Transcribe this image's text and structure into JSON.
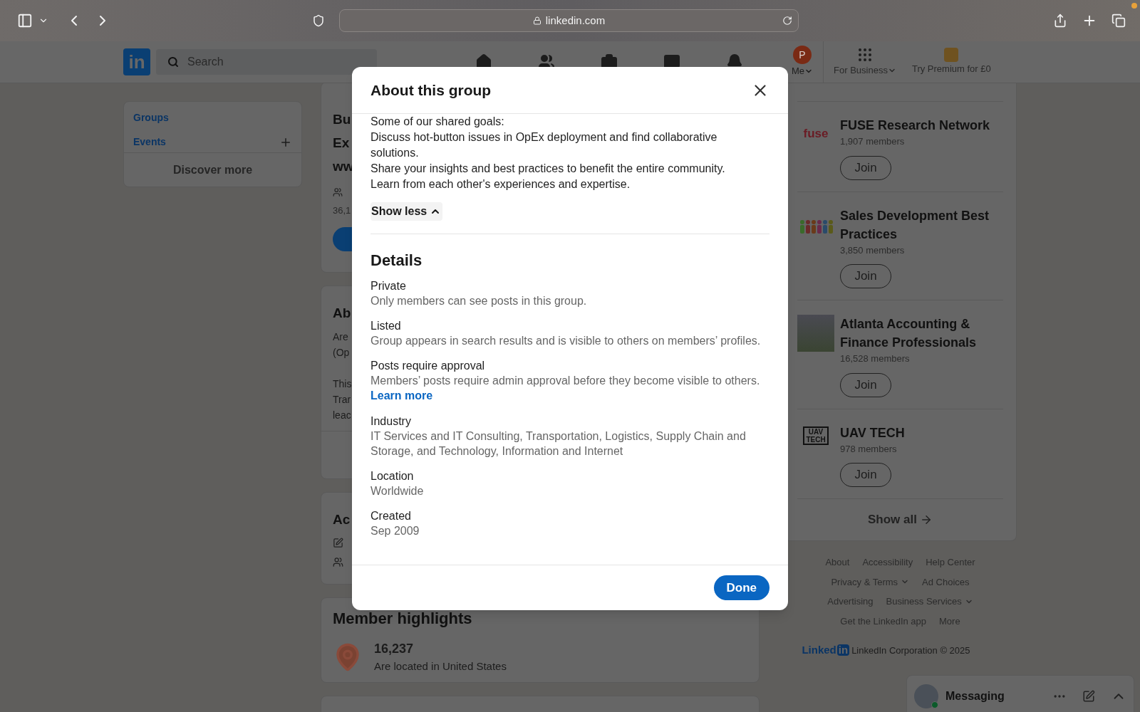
{
  "browser": {
    "url": "linkedin.com"
  },
  "nav": {
    "logo_text": "in",
    "search_placeholder": "Search",
    "avatar_letter": "P",
    "me_label": "Me",
    "for_business": "For Business",
    "premium": "Try Premium for £0"
  },
  "left_nav": {
    "items": [
      {
        "label": "Groups",
        "add": false
      },
      {
        "label": "Events",
        "add": true
      }
    ],
    "discover": "Discover more"
  },
  "group_card": {
    "title_lines": [
      "Bu",
      "Ex",
      "ww"
    ],
    "members": "36,1"
  },
  "about_card": {
    "title": "Ab",
    "paragraphs": [
      [
        "Are",
        "(Op"
      ],
      [
        "This",
        "Trar",
        "leac"
      ]
    ]
  },
  "activity_card": {
    "title": "Ac"
  },
  "member_highlights": {
    "title": "Member highlights",
    "count": "16,237",
    "text": "Are located in United States"
  },
  "suggested_groups": [
    {
      "name": "FUSE Research Network",
      "members": "1,907 members",
      "join": "Join",
      "logo": {
        "kind": "text",
        "text": "fuse"
      }
    },
    {
      "name": "Sales Development Best Practices",
      "members": "3,850 members",
      "join": "Join",
      "logo": {
        "kind": "figures"
      }
    },
    {
      "name": "Atlanta Accounting & Finance Professionals",
      "members": "16,528 members",
      "join": "Join",
      "logo": {
        "kind": "photo"
      }
    },
    {
      "name": "UAV TECH",
      "members": "978 members",
      "join": "Join",
      "logo": {
        "kind": "boxed-text",
        "text": "UAV TECH"
      }
    }
  ],
  "show_all": "Show all",
  "footer_links": [
    [
      {
        "label": "About",
        "menu": false
      },
      {
        "label": "Accessibility",
        "menu": false
      },
      {
        "label": "Help Center",
        "menu": false
      }
    ],
    [
      {
        "label": "Privacy & Terms",
        "menu": true
      },
      {
        "label": "Ad Choices",
        "menu": false
      }
    ],
    [
      {
        "label": "Advertising",
        "menu": false
      },
      {
        "label": "Business Services",
        "menu": true
      }
    ],
    [
      {
        "label": "Get the LinkedIn app",
        "menu": false
      },
      {
        "label": "More",
        "menu": false
      }
    ]
  ],
  "footer_brand": {
    "word": "Linked",
    "badge": "in",
    "text": "LinkedIn Corporation © 2025"
  },
  "messaging": {
    "title": "Messaging",
    "online": true
  },
  "modal": {
    "title": "About this group",
    "intro_lines": [
      "Some of our shared goals:",
      "Discuss hot-button issues in OpEx deployment and find collaborative solutions.",
      "Share your insights and best practices to benefit the entire community.",
      "Learn from each other's experiences and expertise."
    ],
    "show_less": "Show less",
    "details_title": "Details",
    "details": [
      {
        "label": "Private",
        "text": "Only members can see posts in this group."
      },
      {
        "label": "Listed",
        "text": "Group appears in search results and is visible to others on members’ profiles."
      },
      {
        "label": "Posts require approval",
        "text": "Members’ posts require admin approval before they become visible to others.",
        "link": "Learn more"
      },
      {
        "label": "Industry",
        "text": "IT Services and IT Consulting, Transportation, Logistics, Supply Chain and Storage, and Technology, Information and Internet"
      },
      {
        "label": "Location",
        "text": "Worldwide"
      },
      {
        "label": "Created",
        "text": "Sep 2009"
      }
    ],
    "done": "Done"
  }
}
